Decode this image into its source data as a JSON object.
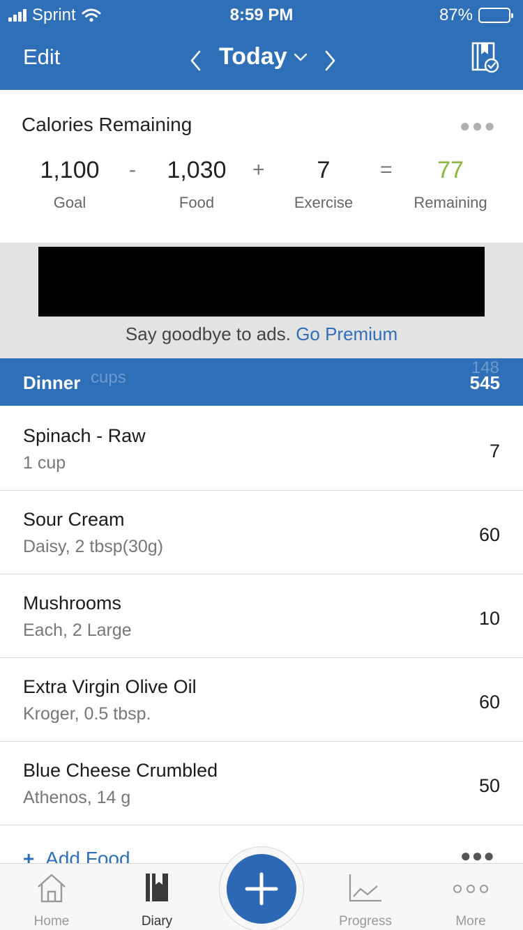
{
  "status": {
    "carrier": "Sprint",
    "time": "8:59 PM",
    "battery": "87%",
    "battery_level": 0.87
  },
  "nav": {
    "edit": "Edit",
    "title": "Today"
  },
  "calories": {
    "heading": "Calories Remaining",
    "goal": "1,100",
    "goal_label": "Goal",
    "op_minus": "-",
    "food": "1,030",
    "food_label": "Food",
    "op_plus": "+",
    "exercise": "7",
    "exercise_label": "Exercise",
    "op_equals": "=",
    "remaining": "77",
    "remaining_label": "Remaining",
    "remaining_color": "#8ab53f"
  },
  "ad": {
    "promo_text": "Say goodbye to ads.",
    "promo_link": "Go Premium"
  },
  "meal": {
    "name": "Dinner",
    "total": "545",
    "behind_left": "cups",
    "behind_right": "148"
  },
  "foods": [
    {
      "name": "Spinach - Raw",
      "desc": "1 cup",
      "cal": "7"
    },
    {
      "name": "Sour Cream",
      "desc": "Daisy, 2 tbsp(30g)",
      "cal": "60"
    },
    {
      "name": "Mushrooms",
      "desc": "Each, 2 Large",
      "cal": "10"
    },
    {
      "name": "Extra Virgin Olive Oil",
      "desc": "Kroger, 0.5 tbsp.",
      "cal": "60"
    },
    {
      "name": "Blue Cheese Crumbled",
      "desc": "Athenos, 14 g",
      "cal": "50"
    }
  ],
  "add_food": "Add Food",
  "tabs": {
    "home": "Home",
    "diary": "Diary",
    "progress": "Progress",
    "more": "More"
  },
  "colors": {
    "brand_blue": "#2f6fb7",
    "link_blue": "#2f6fb7"
  }
}
